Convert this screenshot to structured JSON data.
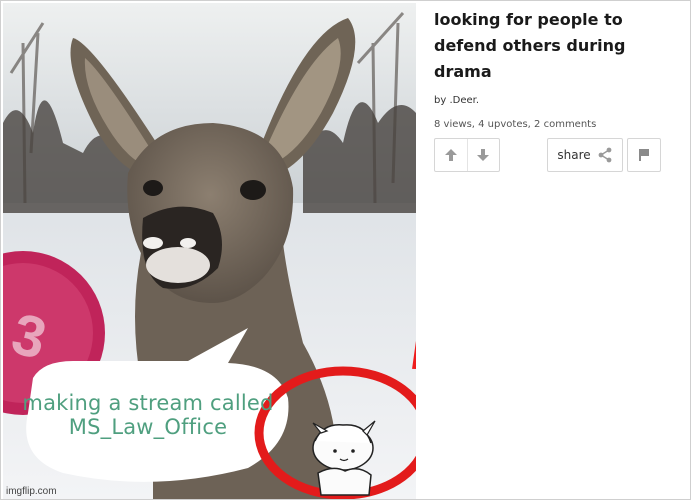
{
  "post": {
    "title": "looking for people to defend others during drama",
    "by_prefix": "by ",
    "author": ".Deer.",
    "stats": "8 views, 4 upvotes, 2 comments"
  },
  "meme": {
    "caption": "making a stream called MS_Law_Office",
    "watermark": "imgflip.com",
    "channel_logo_text": "3"
  },
  "actions": {
    "share_label": "share"
  },
  "icons": {
    "upvote": "arrow-up-icon",
    "downvote": "arrow-down-icon",
    "share": "share-nodes-icon",
    "flag": "flag-icon"
  },
  "colors": {
    "caption_text": "#4f9f7f",
    "arrow_red": "#ee1c1c",
    "circle_red": "#e31b1b",
    "logo_pink": "#c0245a"
  }
}
